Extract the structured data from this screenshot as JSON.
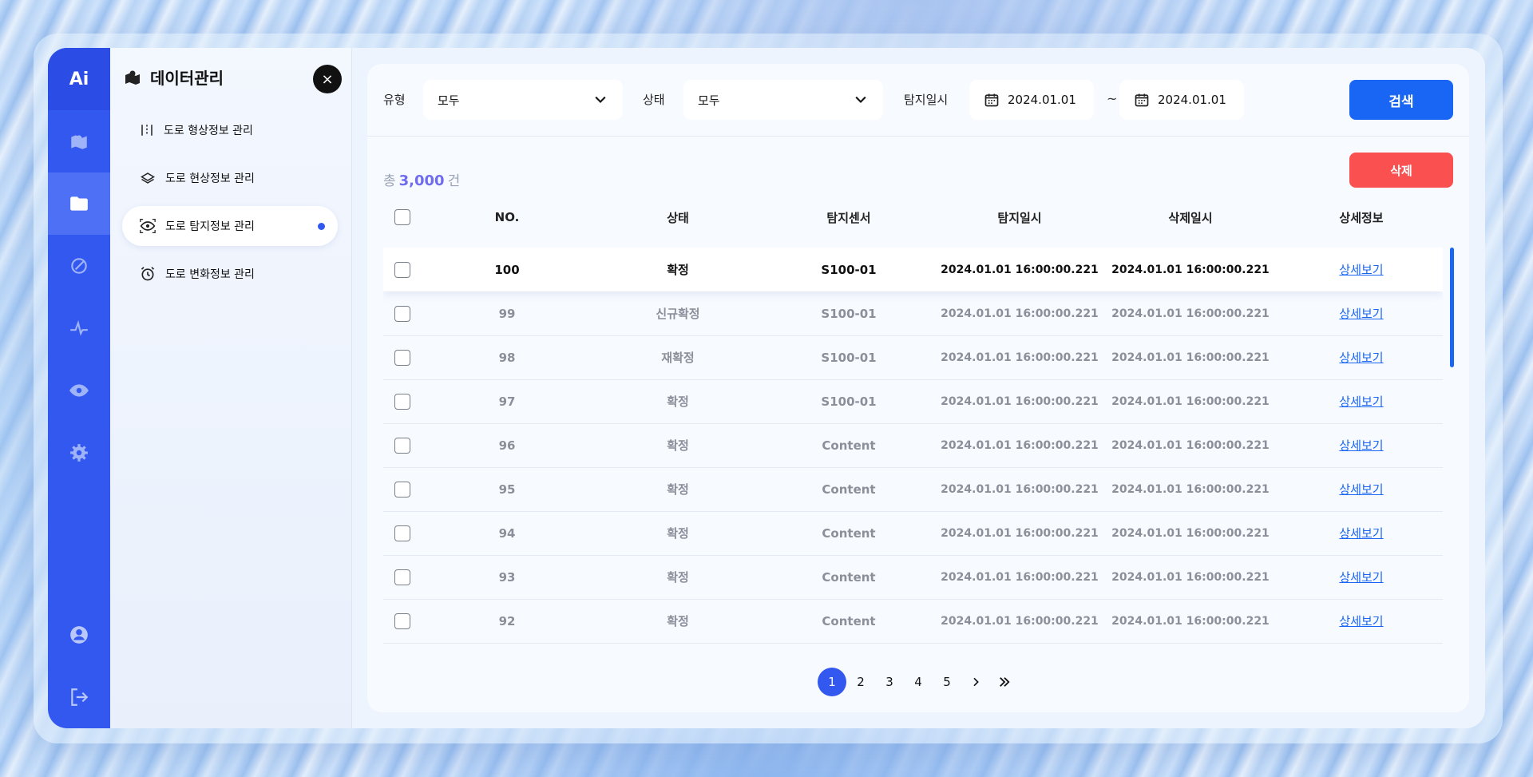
{
  "rail": {
    "logo": "Ai",
    "items": [
      {
        "icon": "map-icon"
      },
      {
        "icon": "folder-icon",
        "active": true
      },
      {
        "icon": "compass-icon"
      },
      {
        "icon": "pulse-icon"
      },
      {
        "icon": "eye-icon"
      },
      {
        "icon": "gear-icon"
      },
      {
        "icon": "user-icon"
      },
      {
        "icon": "logout-icon"
      }
    ]
  },
  "menu": {
    "title": "데이터관리",
    "close": "×",
    "items": [
      {
        "label": "도로 형상정보 관리",
        "icon": "road-lines-icon"
      },
      {
        "label": "도로 현상정보 관리",
        "icon": "layers-icon"
      },
      {
        "label": "도로 탐지정보 관리",
        "icon": "detect-eye-icon",
        "active": true
      },
      {
        "label": "도로 변화정보 관리",
        "icon": "alarm-clock-icon"
      }
    ]
  },
  "filters": {
    "type_label": "유형",
    "type_value": "모두",
    "status_label": "상태",
    "status_value": "모두",
    "date_label": "탐지일시",
    "date_from": "2024.01.01",
    "date_sep": "~",
    "date_to": "2024.01.01",
    "search_label": "검색"
  },
  "summary": {
    "prefix": "총",
    "count": "3,000",
    "suffix": "건"
  },
  "delete_label": "삭제",
  "table": {
    "headers": [
      "NO.",
      "상태",
      "탐지센서",
      "탐지일시",
      "삭제일시",
      "상세정보"
    ],
    "rows": [
      {
        "no": "100",
        "status": "확정",
        "sensor": "S100-01",
        "detected": "2024.01.01 16:00:00.221",
        "deleted": "2024.01.01 16:00:00.221",
        "link": "상세보기"
      },
      {
        "no": "99",
        "status": "신규확정",
        "sensor": "S100-01",
        "detected": "2024.01.01 16:00:00.221",
        "deleted": "2024.01.01 16:00:00.221",
        "link": "상세보기"
      },
      {
        "no": "98",
        "status": "재확정",
        "sensor": "S100-01",
        "detected": "2024.01.01 16:00:00.221",
        "deleted": "2024.01.01 16:00:00.221",
        "link": "상세보기"
      },
      {
        "no": "97",
        "status": "확정",
        "sensor": "S100-01",
        "detected": "2024.01.01 16:00:00.221",
        "deleted": "2024.01.01 16:00:00.221",
        "link": "상세보기"
      },
      {
        "no": "96",
        "status": "확정",
        "sensor": "Content",
        "detected": "2024.01.01 16:00:00.221",
        "deleted": "2024.01.01 16:00:00.221",
        "link": "상세보기"
      },
      {
        "no": "95",
        "status": "확정",
        "sensor": "Content",
        "detected": "2024.01.01 16:00:00.221",
        "deleted": "2024.01.01 16:00:00.221",
        "link": "상세보기"
      },
      {
        "no": "94",
        "status": "확정",
        "sensor": "Content",
        "detected": "2024.01.01 16:00:00.221",
        "deleted": "2024.01.01 16:00:00.221",
        "link": "상세보기"
      },
      {
        "no": "93",
        "status": "확정",
        "sensor": "Content",
        "detected": "2024.01.01 16:00:00.221",
        "deleted": "2024.01.01 16:00:00.221",
        "link": "상세보기"
      },
      {
        "no": "92",
        "status": "확정",
        "sensor": "Content",
        "detected": "2024.01.01 16:00:00.221",
        "deleted": "2024.01.01 16:00:00.221",
        "link": "상세보기"
      }
    ]
  },
  "pagination": {
    "pages": [
      "1",
      "2",
      "3",
      "4",
      "5"
    ],
    "current": "1",
    "next": "›",
    "last": "»"
  },
  "colors": {
    "accent": "#3358f0",
    "search": "#1966f5",
    "delete": "#fb5050"
  }
}
